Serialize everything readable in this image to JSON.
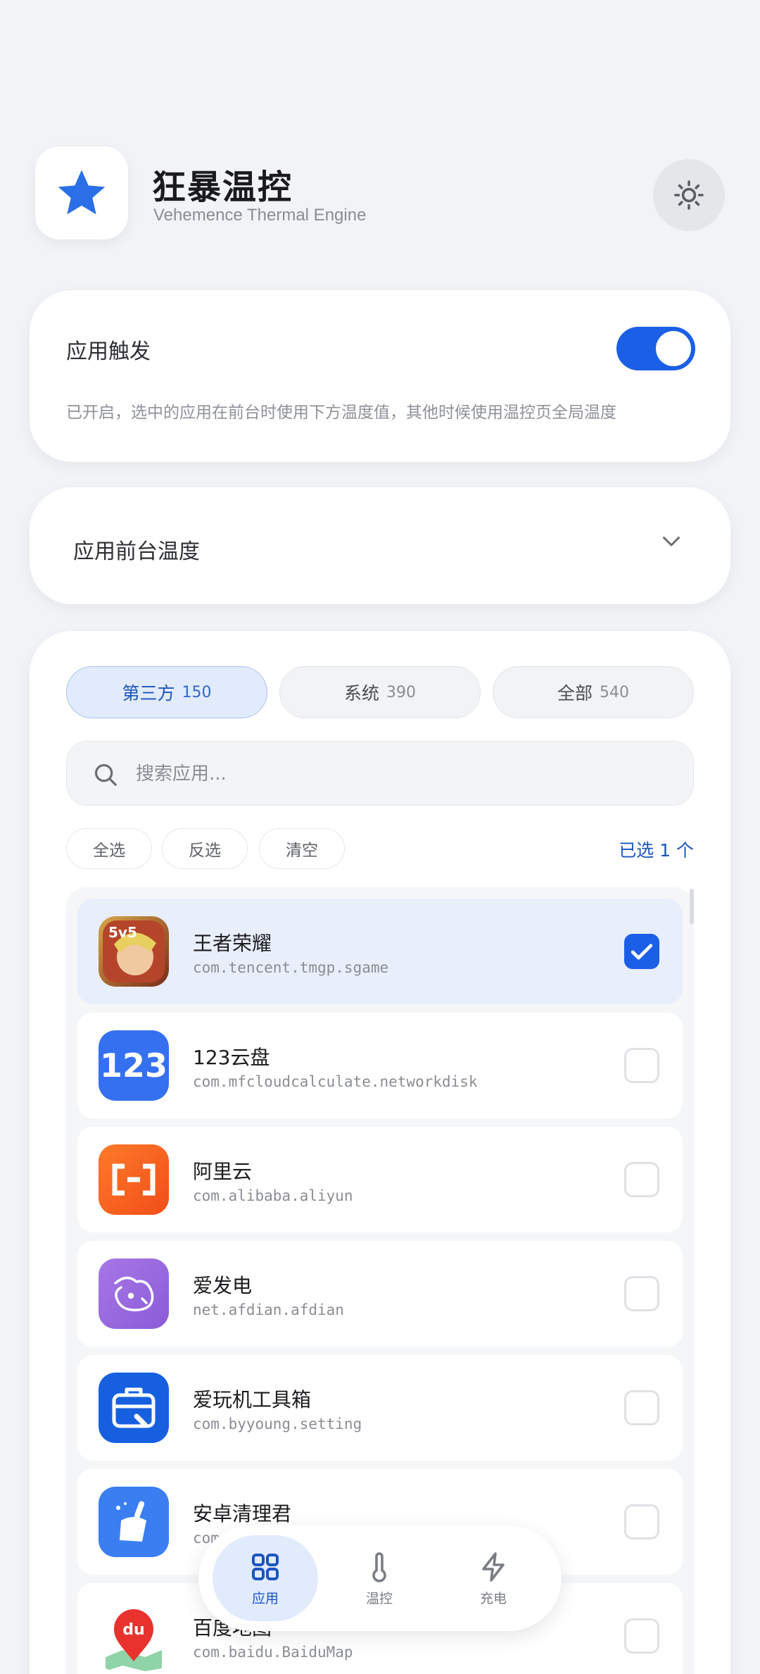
{
  "header": {
    "title": "狂暴温控",
    "subtitle": "Vehemence Thermal Engine",
    "logo_icon": "star-icon",
    "theme_icon": "sun-icon"
  },
  "trigger_card": {
    "title": "应用触发",
    "enabled": true,
    "description": "已开启，选中的应用在前台时使用下方温度值，其他时候使用温控页全局温度"
  },
  "temp_card": {
    "title": "应用前台温度"
  },
  "tabs": [
    {
      "label": "第三方",
      "count": "150",
      "active": true
    },
    {
      "label": "系统",
      "count": "390",
      "active": false
    },
    {
      "label": "全部",
      "count": "540",
      "active": false
    }
  ],
  "search": {
    "placeholder": "搜索应用...",
    "value": ""
  },
  "actions": {
    "select_all": "全选",
    "invert": "反选",
    "clear": "清空",
    "selected_count": "已选 1 个"
  },
  "apps": [
    {
      "name": "王者荣耀",
      "package": "com.tencent.tmgp.sgame",
      "checked": true
    },
    {
      "name": "123云盘",
      "package": "com.mfcloudcalculate.networkdisk",
      "checked": false
    },
    {
      "name": "阿里云",
      "package": "com.alibaba.aliyun",
      "checked": false
    },
    {
      "name": "爱发电",
      "package": "net.afdian.afdian",
      "checked": false
    },
    {
      "name": "爱玩机工具箱",
      "package": "com.byyoung.setting",
      "checked": false
    },
    {
      "name": "安卓清理君",
      "package": "com",
      "checked": false
    },
    {
      "name": "百度地图",
      "package": "com.baidu.BaiduMap",
      "checked": false
    }
  ],
  "nav": [
    {
      "label": "应用",
      "icon": "grid-icon",
      "active": true
    },
    {
      "label": "温控",
      "icon": "thermometer-icon",
      "active": false
    },
    {
      "label": "充电",
      "icon": "lightning-icon",
      "active": false
    }
  ],
  "colors": {
    "accent": "#1a5fe6",
    "background": "#f1f3f6"
  }
}
